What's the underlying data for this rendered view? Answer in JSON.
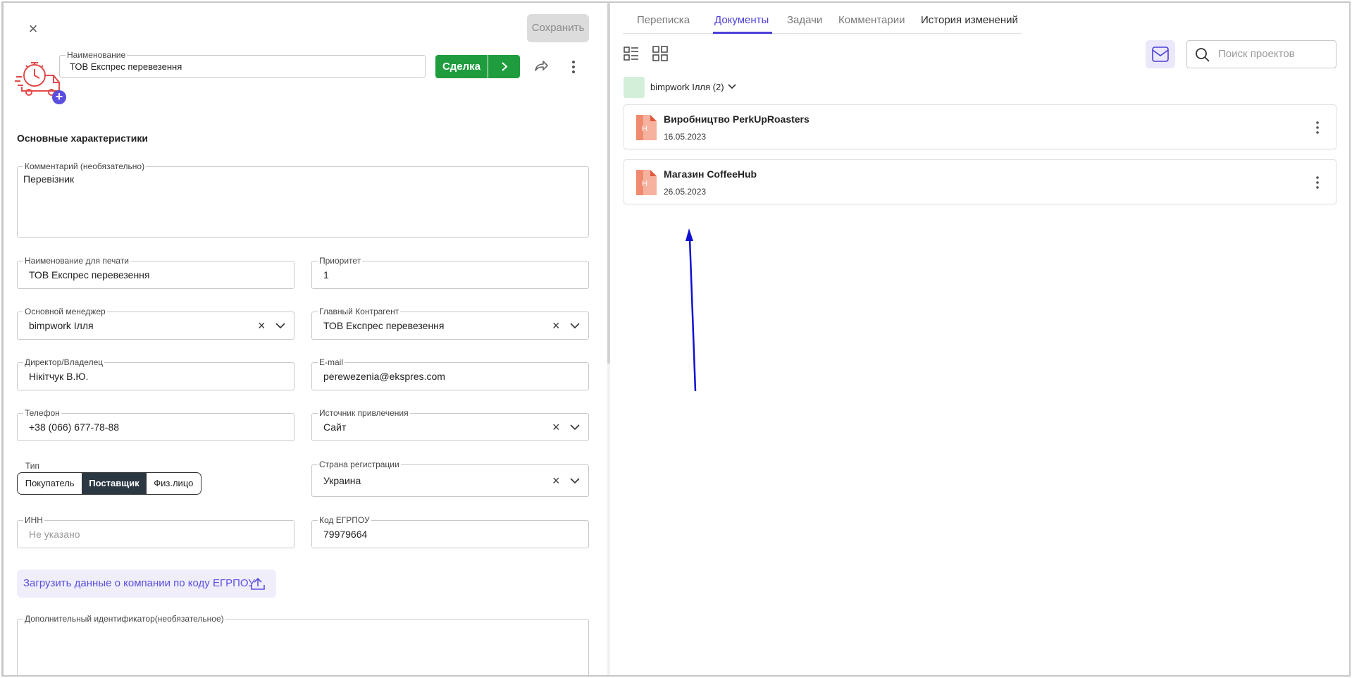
{
  "header": {
    "save_label": "Сохранить",
    "name_label": "Наименование",
    "name_value": "ТОВ Експрес перевезення",
    "deal_label": "Сделка"
  },
  "section": {
    "title": "Основные характеристики"
  },
  "fields": {
    "comment": {
      "label": "Комментарий (необязательно)",
      "value": "Перевізник"
    },
    "print_name": {
      "label": "Наименование для печати",
      "value": "ТОВ Експрес перевезення"
    },
    "priority": {
      "label": "Приоритет",
      "value": "1"
    },
    "manager": {
      "label": "Основной менеджер",
      "value": "bimpwork Ілля"
    },
    "main_contractor": {
      "label": "Главный Контрагент",
      "value": "ТОВ Експрес перевезення"
    },
    "director": {
      "label": "Директор/Владелец",
      "value": "Нікітчук В.Ю."
    },
    "email": {
      "label": "E-mail",
      "value": "perewezenia@ekspres.com"
    },
    "phone": {
      "label": "Телефон",
      "value": "+38 (066) 677-78-88"
    },
    "source": {
      "label": "Источник привлечения",
      "value": "Сайт"
    },
    "type": {
      "label": "Тип",
      "options": [
        "Покупатель",
        "Поставщик",
        "Физ.лицо"
      ],
      "selected": "Поставщик"
    },
    "country": {
      "label": "Страна регистрации",
      "value": "Украина"
    },
    "inn": {
      "label": "ИНН",
      "placeholder": "Не указано"
    },
    "edrpou": {
      "label": "Код ЕГРПОУ",
      "value": "79979664"
    },
    "extra_id": {
      "label": "Дополнительный идентификатор(необязательное)",
      "value": ""
    }
  },
  "load_button": {
    "label": "Загрузить данные о компании по коду ЕГРПОУ"
  },
  "right": {
    "tabs": [
      "Переписка",
      "Документы",
      "Задачи",
      "Комментарии",
      "История изменений"
    ],
    "active_tab": "Документы",
    "search_placeholder": "Поиск проектов",
    "group_label": "bimpwork Ілля (2)",
    "documents": [
      {
        "title": "Виробництво PerkUpRoasters",
        "date": "16.05.2023",
        "icon_letter": "H"
      },
      {
        "title": "Магазин CoffeeHub",
        "date": "26.05.2023",
        "icon_letter": "H"
      }
    ]
  },
  "colors": {
    "accent": "#4b3fd6",
    "deal_green": "#1f9d3e",
    "type_selected": "#2b3843",
    "annotation_arrow": "#1010d0",
    "doc_icon": "#f08a6e"
  }
}
